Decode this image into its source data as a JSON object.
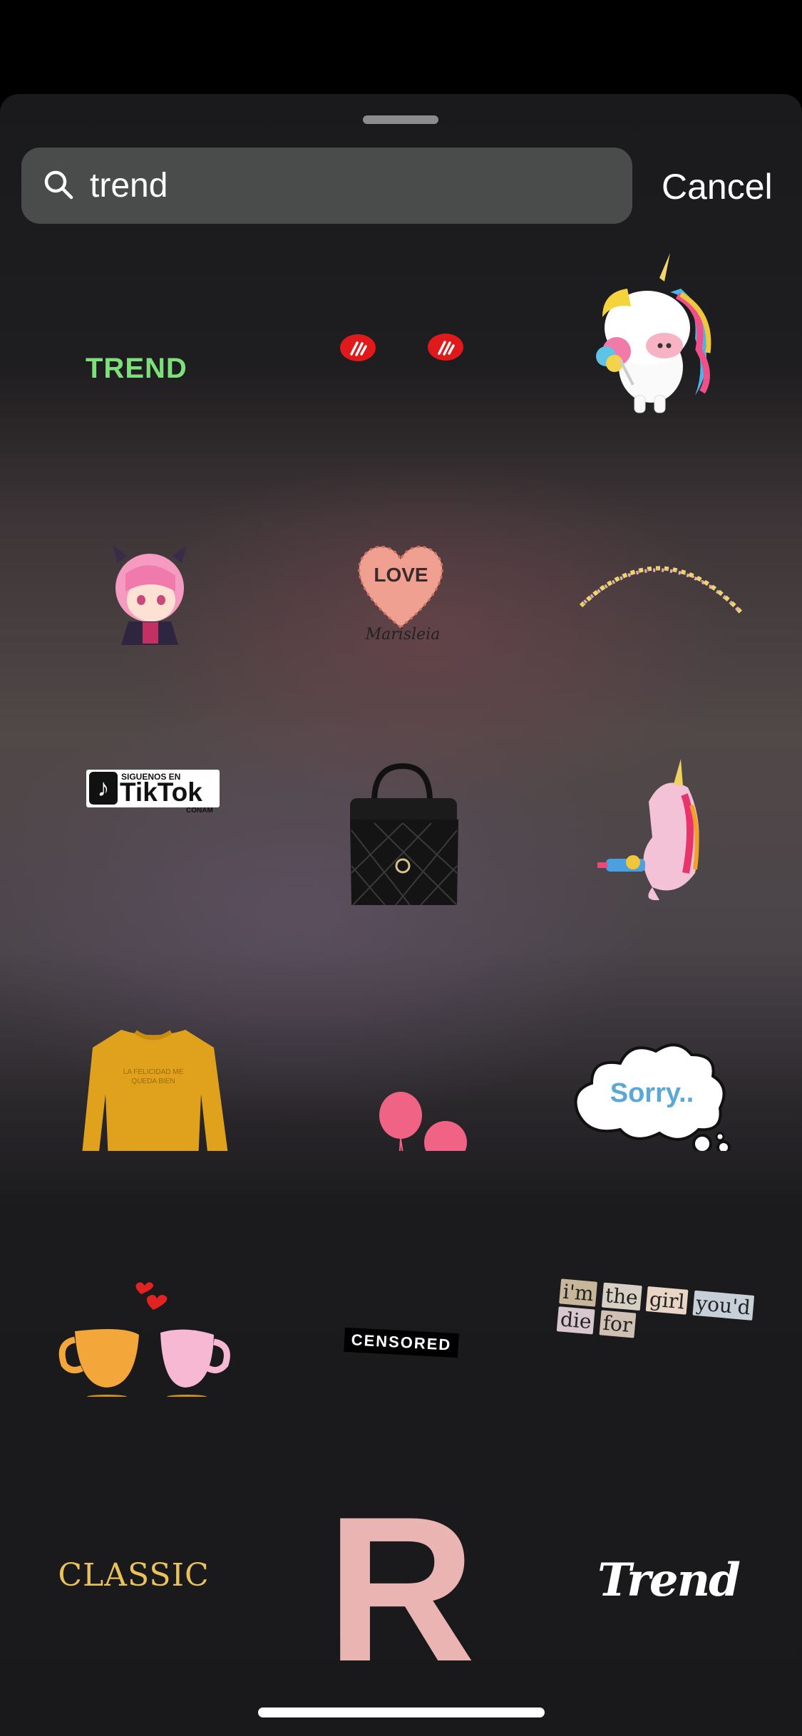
{
  "search": {
    "query": "trend",
    "cancel_label": "Cancel"
  },
  "stickers": {
    "trend_text": "TREND",
    "love_text": "LOVE",
    "love_signature": "Marisleia",
    "tiktok_small": "SIGUENOS EN",
    "tiktok_big": "TikTok",
    "tiktok_sub": "CONAM",
    "sweater_text": "LA FELICIDAD ME QUEDA BIEN",
    "sorry_text": "Sorry..",
    "censored_text": "CENSORED",
    "collage_words": [
      "i'm",
      "the",
      "girl",
      "you'd",
      "die",
      "for"
    ],
    "classic_text": "CLASSIC",
    "big_letter": "R",
    "trend_script": "Trend"
  },
  "colors": {
    "accent_green": "#7ee07a",
    "classic_gold": "#e9c25c",
    "big_letter_pink": "#e9b4b2"
  }
}
